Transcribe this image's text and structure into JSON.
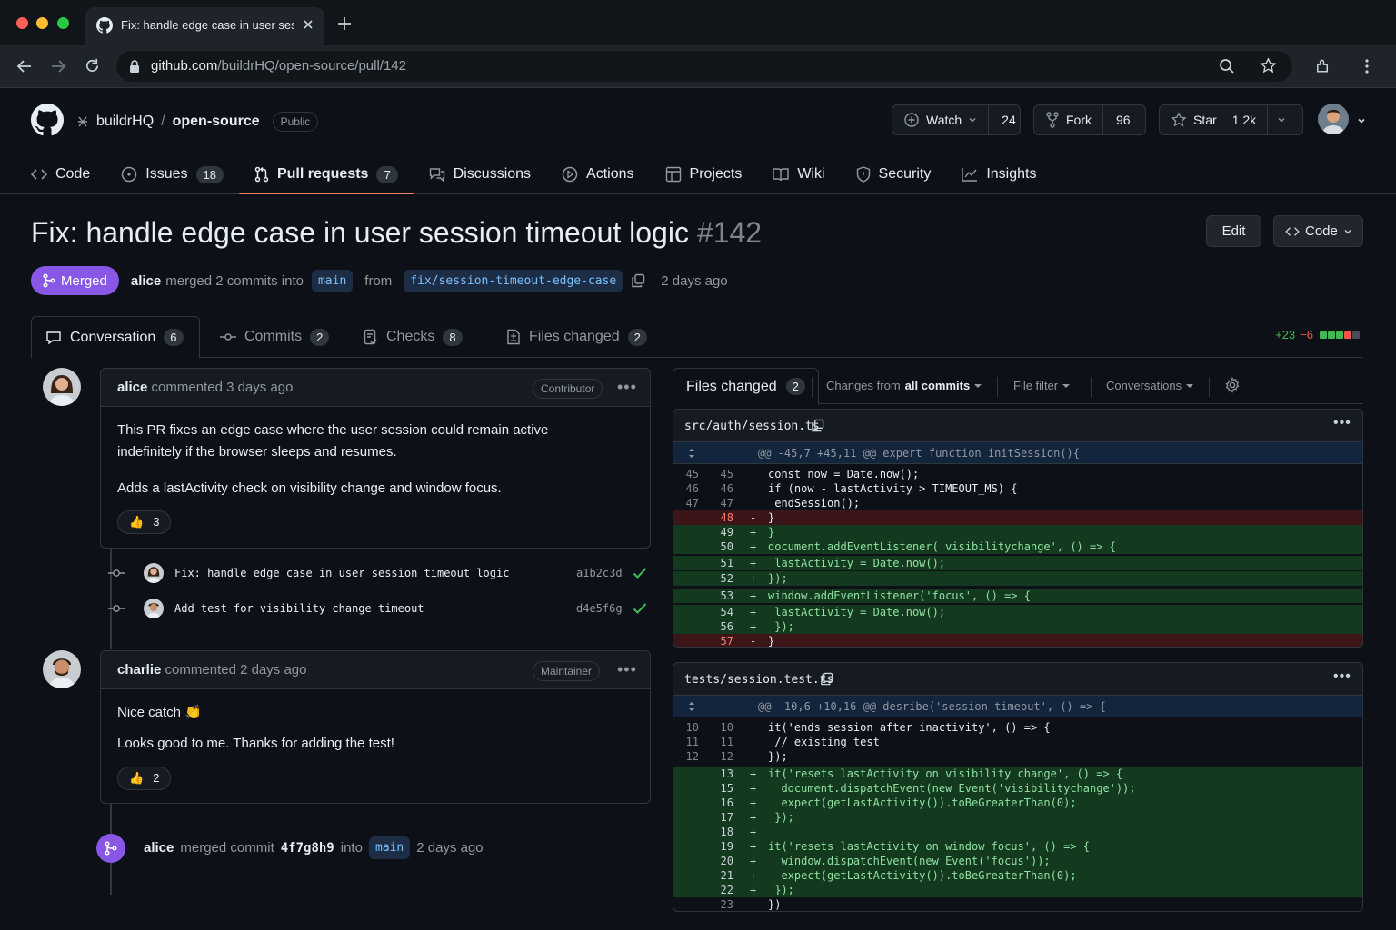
{
  "browser": {
    "tab_title": "Fix: handle edge case in user session timeout logic",
    "url_host": "github.com",
    "url_path": "/buildrHQ/open-source/pull/142"
  },
  "repo": {
    "owner": "buildrHQ",
    "name": "open-source",
    "visibility": "Public",
    "watch_label": "Watch",
    "watch_count": "24",
    "fork_label": "Fork",
    "fork_count": "96",
    "star_label": "Star",
    "star_count": "1.2k"
  },
  "nav": {
    "code": "Code",
    "issues": "Issues",
    "issues_count": "18",
    "pulls": "Pull requests",
    "pulls_count": "7",
    "discussions": "Discussions",
    "actions": "Actions",
    "projects": "Projects",
    "wiki": "Wiki",
    "security": "Security",
    "insights": "Insights"
  },
  "pr": {
    "title": "Fix: handle edge case in user session timeout logic",
    "number": "#142",
    "edit_label": "Edit",
    "code_label": "Code",
    "state": "Merged",
    "author": "alice",
    "merge_text": "merged 2 commits into",
    "base_branch": "main",
    "from_text": "from",
    "head_branch": "fix/session-timeout-edge-case",
    "age": "2 days ago"
  },
  "tabs": {
    "conversation": "Conversation",
    "conversation_count": "6",
    "commits": "Commits",
    "commits_count": "2",
    "checks": "Checks",
    "checks_count": "8",
    "files": "Files changed",
    "files_count": "2",
    "additions": "+23",
    "deletions": "−6"
  },
  "comments": [
    {
      "author": "alice",
      "when": "commented 3 days ago",
      "role": "Contributor",
      "p1": "This PR fixes an edge case where the user session could remain active indefinitely if the browser sleeps and resumes.",
      "p2": "Adds a lastActivity check on visibility change and window focus.",
      "reaction": "👍",
      "reaction_count": "3"
    },
    {
      "author": "charlie",
      "when": "commented 2 days ago",
      "role": "Maintainer",
      "p1": "Nice catch 👏",
      "p2": "Looks good to me. Thanks for adding the test!",
      "reaction": "👍",
      "reaction_count": "2"
    }
  ],
  "commits": [
    {
      "message": "Fix: handle edge case in user session timeout logic",
      "sha": "a1b2c3d"
    },
    {
      "message": "Add test for visibility change timeout",
      "sha": "d4e5f6g"
    }
  ],
  "merge_event": {
    "author": "alice",
    "text": "merged commit",
    "sha": "4f7g8h9",
    "into": "into",
    "branch": "main",
    "when": "2 days ago"
  },
  "files_panel": {
    "tab": "Files changed",
    "tab_count": "2",
    "changes_from": "Changes from",
    "changes_from_value": "all commits",
    "file_filter": "File filter",
    "conversations": "Conversations",
    "files": [
      {
        "name": "src/auth/session.ts",
        "hunk": "@@ -45,7 +45,11 @@ expert function initSession(){",
        "lines": [
          {
            "o": "45",
            "n": "45",
            "t": " ",
            "c": "const now = Date.now();"
          },
          {
            "o": "46",
            "n": "46",
            "t": " ",
            "c": "if (now - lastActivity > TIMEOUT_MS) {"
          },
          {
            "o": "47",
            "n": "47",
            "t": " ",
            "c": " endSession();"
          },
          {
            "o": "",
            "n": "48",
            "t": "-",
            "c": "}"
          },
          {
            "o": "",
            "n": "49",
            "t": "+",
            "c": "}"
          },
          {
            "o": "",
            "n": "50",
            "t": "+",
            "c": "document.addEventListener('visibilitychange', () => {"
          },
          {
            "o": "",
            "n": "51",
            "t": "+",
            "c": " lastActivity = Date.now();"
          },
          {
            "o": "",
            "n": "52",
            "t": "+",
            "c": "});"
          },
          {
            "o": "",
            "n": "53",
            "t": "+",
            "c": "window.addEventListener('focus', () => {"
          },
          {
            "o": "",
            "n": "54",
            "t": "+",
            "c": " lastActivity = Date.now();"
          },
          {
            "o": "",
            "n": "56",
            "t": "+",
            "c": " });"
          },
          {
            "o": "",
            "n": "57",
            "t": "-",
            "c": "}"
          }
        ]
      },
      {
        "name": "tests/session.test.ts",
        "hunk": "@@ -10,6 +10,16 @@ desribe('session timeout', () => {",
        "lines": [
          {
            "o": "10",
            "n": "10",
            "t": " ",
            "c": "it('ends session after inactivity', () => {"
          },
          {
            "o": "11",
            "n": "11",
            "t": " ",
            "c": " // existing test"
          },
          {
            "o": "12",
            "n": "12",
            "t": " ",
            "c": "});"
          },
          {
            "o": "",
            "n": "13",
            "t": "+",
            "c": "it('resets lastActivity on visibility change', () => {"
          },
          {
            "o": "",
            "n": "15",
            "t": "+",
            "c": "  document.dispatchEvent(new Event('visibilitychange'));"
          },
          {
            "o": "",
            "n": "16",
            "t": "+",
            "c": "  expect(getLastActivity()).toBeGreaterThan(0);"
          },
          {
            "o": "",
            "n": "17",
            "t": "+",
            "c": " });"
          },
          {
            "o": "",
            "n": "18",
            "t": "+",
            "c": ""
          },
          {
            "o": "",
            "n": "19",
            "t": "+",
            "c": "it('resets lastActivity on window focus', () => {"
          },
          {
            "o": "",
            "n": "20",
            "t": "+",
            "c": "  window.dispatchEvent(new Event('focus'));"
          },
          {
            "o": "",
            "n": "21",
            "t": "+",
            "c": "  expect(getLastActivity()).toBeGreaterThan(0);"
          },
          {
            "o": "",
            "n": "22",
            "t": "+",
            "c": " });"
          },
          {
            "o": "",
            "n": "23",
            "t": "",
            "c": "})"
          }
        ]
      }
    ]
  },
  "colors": {
    "merged": "#8957e5",
    "accent_tab": "#f78166",
    "added": "#3fb950",
    "deleted": "#f85149"
  }
}
